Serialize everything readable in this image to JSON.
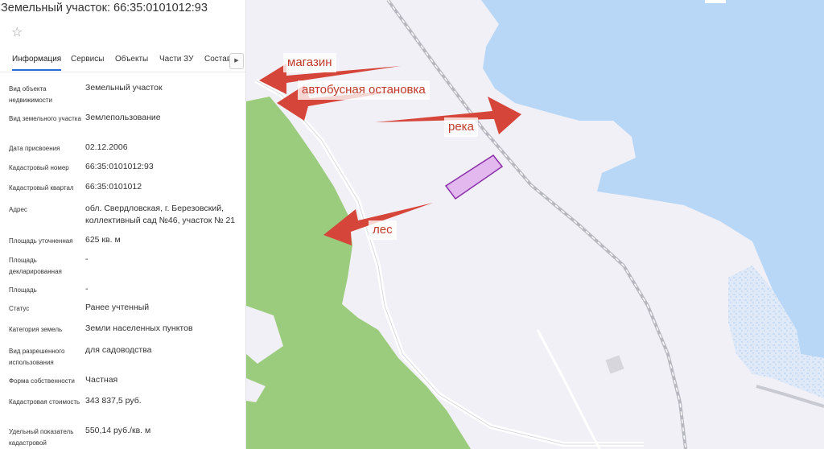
{
  "panel": {
    "title": "Земельный участок: 66:35:0101012:93",
    "star_icon": "star-outline-icon",
    "tabs": [
      "Информация",
      "Сервисы",
      "Объекты",
      "Части ЗУ",
      "Состав"
    ],
    "active_tab": 0,
    "fields": [
      {
        "label": "Вид объекта недвижимости",
        "value": "Земельный участок"
      },
      {
        "label": "Вид земельного участка",
        "value": "Землепользование"
      },
      {
        "label": "Дата присвоения",
        "value": "02.12.2006"
      },
      {
        "label": "Кадастровый номер",
        "value": "66:35:0101012:93"
      },
      {
        "label": "Кадастровый квартал",
        "value": "66:35:0101012"
      },
      {
        "label": "Адрес",
        "value": "обл. Свердловская, г. Березовский, коллективный сад №46, участок № 21"
      },
      {
        "label": "Площадь уточненная",
        "value": "625 кв. м"
      },
      {
        "label": "Площадь декларированная",
        "value": "-"
      },
      {
        "label": "Площадь",
        "value": "-"
      },
      {
        "label": "Статус",
        "value": "Ранее учтенный"
      },
      {
        "label": "Категория земель",
        "value": "Земли населенных пунктов"
      },
      {
        "label": "Вид разрешенного использования",
        "value": "для садоводства"
      },
      {
        "label": "Форма собственности",
        "value": "Частная"
      },
      {
        "label": "Кадастровая стоимость",
        "value": "343 837,5 руб."
      },
      {
        "label": "Удельный показатель кадастровой",
        "value": "550,14 руб./кв. м"
      }
    ]
  },
  "map": {
    "annotations": {
      "shop": "магазин",
      "bus_stop": "автобусная остановка",
      "river": "река",
      "forest": "лес"
    },
    "colors": {
      "water": "#b8d7f7",
      "forest": "#9bcb7c",
      "land": "#f1f0f6",
      "arrow": "#d6453a",
      "parcel_fill": "#e2b8ef",
      "parcel_stroke": "#8a2fa8"
    }
  }
}
